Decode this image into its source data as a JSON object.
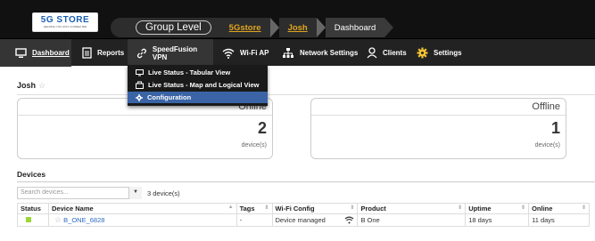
{
  "header": {
    "logo_name": "5G STORE",
    "logo_tagline": "HELPING YOU STAY CONNECTED",
    "breadcrumb": {
      "group": "Group Level",
      "org": "5Gstore",
      "device": "Josh",
      "page": "Dashboard"
    }
  },
  "nav": {
    "items": [
      {
        "label": "Dashboard",
        "icon": "monitor-icon"
      },
      {
        "label": "Reports",
        "icon": "document-icon"
      },
      {
        "label": "SpeedFusion VPN",
        "icon": "link-icon"
      },
      {
        "label": "Wi-Fi AP",
        "icon": "wifi-icon"
      },
      {
        "label": "Network Settings",
        "icon": "network-icon"
      },
      {
        "label": "Clients",
        "icon": "user-icon"
      },
      {
        "label": "Settings",
        "icon": "gear-icon"
      }
    ],
    "dropdown": [
      {
        "label": "Live Status - Tabular View",
        "icon": "monitor-icon"
      },
      {
        "label": "Live Status - Map and Logical View",
        "icon": "map-icon"
      },
      {
        "label": "Configuration",
        "icon": "gear-icon"
      }
    ]
  },
  "page": {
    "title": "Josh",
    "cards": [
      {
        "status": "Online",
        "count": "2",
        "unit": "device(s)"
      },
      {
        "status": "Offline",
        "count": "1",
        "unit": "device(s)"
      }
    ]
  },
  "devices": {
    "title": "Devices",
    "search_placeholder": "Search devices...",
    "count_label": "3 device(s)",
    "columns": [
      "Status",
      "Device Name",
      "Tags",
      "Wi-Fi Config",
      "Product",
      "Uptime",
      "Online"
    ],
    "rows": [
      {
        "status_color": "#9cd53a",
        "name": "B_ONE_6828",
        "tags": "-",
        "wifi": "Device managed",
        "product": "B One",
        "uptime": "18 days",
        "online": "11 days"
      }
    ]
  },
  "colors": {
    "accent": "#e0a520",
    "selected": "#3a64a6",
    "link": "#2a6bbf"
  }
}
